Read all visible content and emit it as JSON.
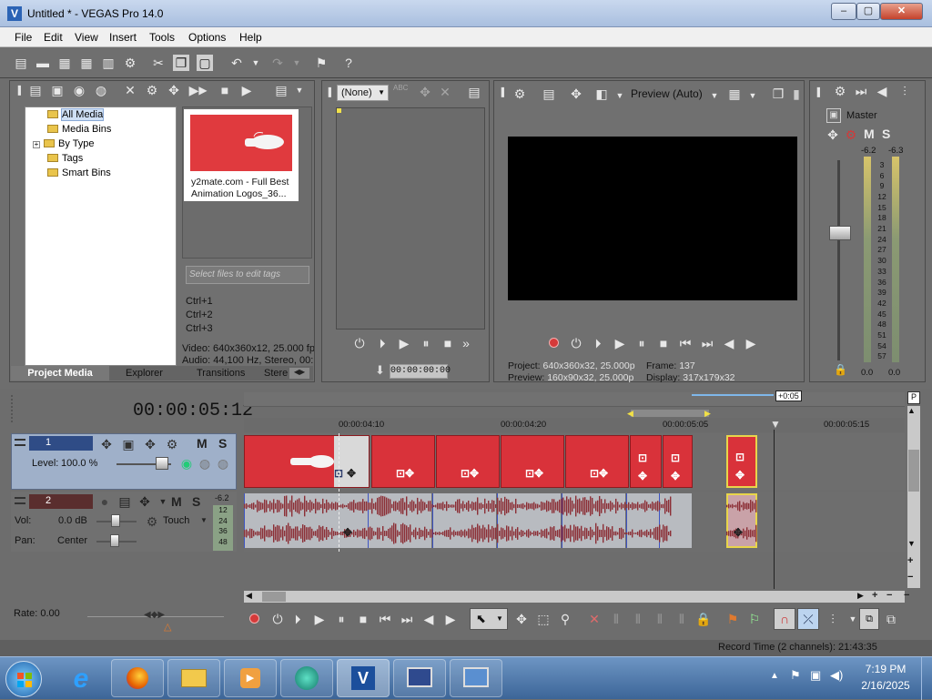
{
  "window": {
    "title": "Untitled * - VEGAS Pro 14.0",
    "minimize": "–",
    "maximize": "▢",
    "close": "✕"
  },
  "menu": [
    "File",
    "Edit",
    "View",
    "Insert",
    "Tools",
    "Options",
    "Help"
  ],
  "explorer": {
    "tree": [
      "All Media",
      "Media Bins",
      "By Type",
      "Tags",
      "Smart Bins"
    ],
    "media_caption": "y2mate.com - Full Best Animation Logos_36...",
    "tags_placeholder": "Select files to edit tags",
    "shortcuts": [
      "Ctrl+1",
      "Ctrl+2",
      "Ctrl+3"
    ],
    "video_info": "Video: 640x360x12, 25.000 fp",
    "audio_info": "Audio: 44,100 Hz, Stereo, 00:",
    "tabs": [
      "Project Media",
      "Explorer",
      "Transitions",
      "Stereo"
    ]
  },
  "trimmer": {
    "dropdown": "(None)",
    "timecode": "00:00:00:00"
  },
  "preview": {
    "mode": "Preview (Auto)",
    "project_label": "Project:",
    "project_value": "640x360x32, 25.000p",
    "frame_label": "Frame:",
    "frame_value": "137",
    "preview_label": "Preview:",
    "preview_value": "160x90x32, 25.000p",
    "display_label": "Display:",
    "display_value": "317x179x32"
  },
  "master": {
    "label": "Master",
    "left_peak": "-6.2",
    "right_peak": "-6.3",
    "scale": [
      "3",
      "6",
      "9",
      "12",
      "15",
      "18",
      "21",
      "24",
      "27",
      "30",
      "33",
      "36",
      "39",
      "42",
      "45",
      "48",
      "51",
      "54",
      "57"
    ],
    "bottom_left": "0.0",
    "bottom_right": "0.0"
  },
  "timeline": {
    "timecode": "00:00:05:12",
    "offset": "+0:05",
    "ruler": [
      "00:00:04:10",
      "00:00:04:20",
      "00:00:05:05",
      "00:00:05:15"
    ],
    "track1": {
      "number": "1",
      "level_label": "Level:",
      "level_value": "100.0 %",
      "m": "M",
      "s": "S"
    },
    "track2": {
      "number": "2",
      "vol_label": "Vol:",
      "vol_value": "0.0 dB",
      "pan_label": "Pan:",
      "pan_value": "Center",
      "automation": "Touch",
      "m": "M",
      "s": "S",
      "meter_peak": "-6.2",
      "meter_scale": [
        "12",
        "24",
        "36",
        "48"
      ]
    },
    "rate": "Rate: 0.00"
  },
  "status": {
    "record": "Record Time (2 channels): 21:43:35"
  },
  "taskbar": {
    "time": "7:19 PM",
    "date": "2/16/2025"
  },
  "colors": {
    "clip_red": "#d9323a",
    "titlebar": "#b8cbe6",
    "taskbar": "#4f78ad"
  }
}
